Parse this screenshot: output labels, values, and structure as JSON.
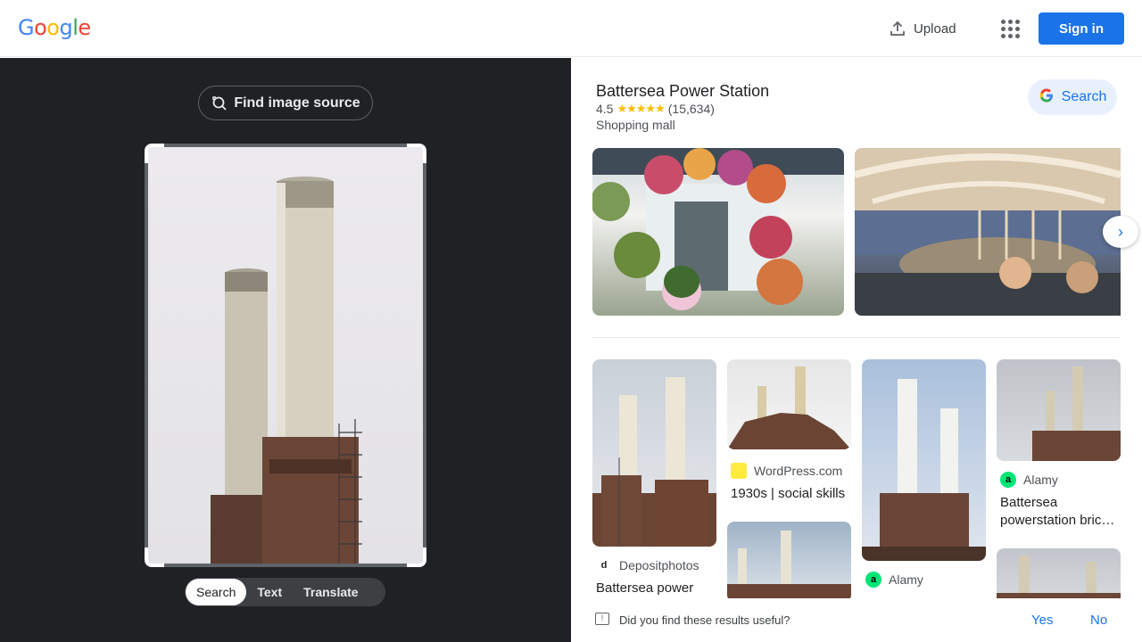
{
  "header": {
    "logo_letters": [
      {
        "ch": "G",
        "color": "#4285F4"
      },
      {
        "ch": "o",
        "color": "#EA4335"
      },
      {
        "ch": "o",
        "color": "#FBBC05"
      },
      {
        "ch": "g",
        "color": "#4285F4"
      },
      {
        "ch": "l",
        "color": "#34A853"
      },
      {
        "ch": "e",
        "color": "#EA4335"
      }
    ],
    "upload_label": "Upload",
    "apps_icon": "apps-grid-icon",
    "signin_label": "Sign in"
  },
  "left": {
    "find_source_label": "Find image source",
    "modes": [
      "Search",
      "Text",
      "Translate"
    ],
    "active_mode": "Search"
  },
  "knowledge_panel": {
    "title": "Battersea Power Station",
    "rating": "4.5",
    "stars": "★★★★★",
    "reviews": "(15,634)",
    "category": "Shopping mall",
    "search_label": "Search"
  },
  "results": [
    {
      "source": "Depositphotos",
      "source_icon_text": "d",
      "source_icon_color": "#202124",
      "title": "Battersea power"
    },
    {
      "source": "WordPress.com",
      "source_icon_text": "",
      "source_icon_color": "#ffeb3b",
      "title": "1930s | social skills"
    },
    {
      "source": "Alamy",
      "source_icon_text": "a",
      "source_icon_color": "#00e676",
      "title": ""
    },
    {
      "source": "Alamy",
      "source_icon_text": "a",
      "source_icon_color": "#00e676",
      "title": "Battersea powerstation bric…"
    }
  ],
  "feedback": {
    "question": "Did you find these results useful?",
    "yes": "Yes",
    "no": "No"
  },
  "colors": {
    "accent": "#1a73e8",
    "dark_panel": "#202124"
  }
}
